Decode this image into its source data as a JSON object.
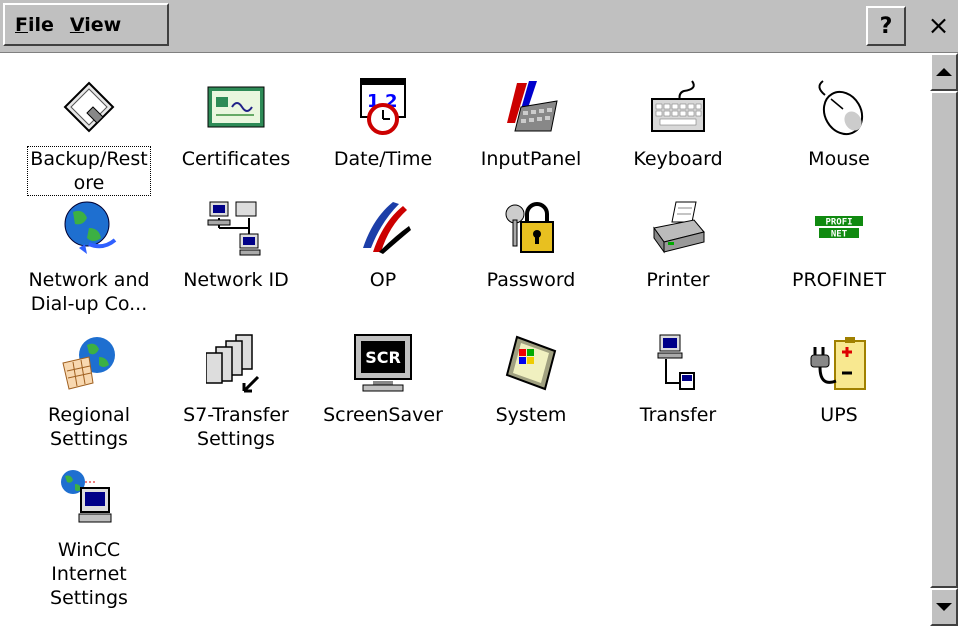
{
  "menu": {
    "file_prefix": "F",
    "file_rest": "ile",
    "view_prefix": "V",
    "view_rest": "iew"
  },
  "title_buttons": {
    "help": "?",
    "close": "×"
  },
  "items": [
    {
      "label": "Backup/Rest\nore",
      "icon": "floppy-disk-icon"
    },
    {
      "label": "Certificates",
      "icon": "certificate-icon"
    },
    {
      "label": "Date/Time",
      "icon": "calendar-clock-icon"
    },
    {
      "label": "InputPanel",
      "icon": "input-panel-icon"
    },
    {
      "label": "Keyboard",
      "icon": "keyboard-icon"
    },
    {
      "label": "Mouse",
      "icon": "mouse-icon"
    },
    {
      "label": "Network and\nDial-up Co...",
      "icon": "globe-network-icon"
    },
    {
      "label": "Network ID",
      "icon": "network-computers-icon"
    },
    {
      "label": "OP",
      "icon": "op-swoosh-icon"
    },
    {
      "label": "Password",
      "icon": "padlock-keys-icon"
    },
    {
      "label": "Printer",
      "icon": "printer-icon"
    },
    {
      "label": "PROFINET",
      "icon": "profinet-icon"
    },
    {
      "label": "Regional\nSettings",
      "icon": "globe-calendar-icon"
    },
    {
      "label": "S7-Transfer\nSettings",
      "icon": "s7-transfer-icon"
    },
    {
      "label": "ScreenSaver",
      "icon": "screensaver-monitor-icon"
    },
    {
      "label": "System",
      "icon": "system-pda-icon"
    },
    {
      "label": "Transfer",
      "icon": "transfer-computer-icon"
    },
    {
      "label": "UPS",
      "icon": "battery-plug-icon"
    },
    {
      "label": "WinCC\nInternet\nSettings",
      "icon": "globe-computer-icon"
    }
  ],
  "screensaver_text": "SCR",
  "profinet_text": [
    "PROFI",
    "NET"
  ],
  "selected_item": "Backup/Restore"
}
